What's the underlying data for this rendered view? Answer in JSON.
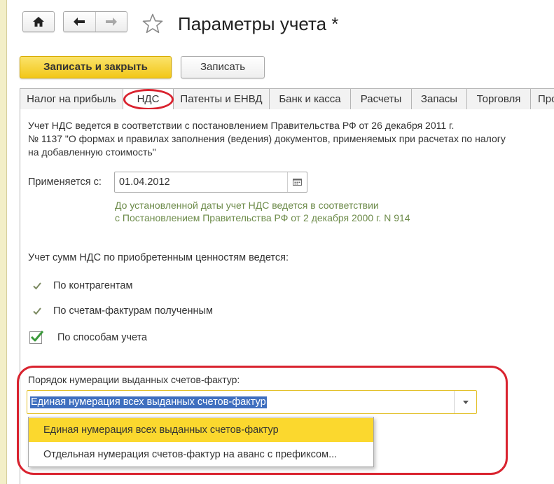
{
  "header": {
    "title": "Параметры учета *"
  },
  "toolbar": {
    "save_close_label": "Записать и закрыть",
    "save_label": "Записать"
  },
  "tabs": [
    {
      "label": "Налог на прибыль",
      "active": false
    },
    {
      "label": "НДС",
      "active": true
    },
    {
      "label": "Патенты и ЕНВД",
      "active": false
    },
    {
      "label": "Банк и касса",
      "active": false
    },
    {
      "label": "Расчеты",
      "active": false
    },
    {
      "label": "Запасы",
      "active": false
    },
    {
      "label": "Торговля",
      "active": false
    },
    {
      "label": "Про",
      "active": false
    }
  ],
  "vat": {
    "intro_lines": [
      "Учет НДС ведется в соответствии с постановлением Правительства РФ от 26 декабря 2011 г.",
      "№ 1137 \"О формах и правилах заполнения (ведения) документов, применяемых при расчетах по налогу",
      "на добавленную стоимость\""
    ],
    "applied_from_label": "Применяется с:",
    "applied_from_value": "01.04.2012",
    "hint_lines": [
      "До установленной даты учет НДС ведется в соответствии",
      "с Постановлением Правительства РФ от 2 декабря 2000 г. N 914"
    ],
    "tracking_label": "Учет сумм НДС по приобретенным ценностям ведется:",
    "tracking_options": [
      {
        "label": "По контрагентам",
        "type": "fixed-tick"
      },
      {
        "label": "По счетам-фактурам полученным",
        "type": "fixed-tick"
      },
      {
        "label": "По способам учета",
        "type": "checkbox",
        "checked": true
      }
    ],
    "numbering_label": "Порядок нумерации выданных счетов-фактур:",
    "numbering_value": "Единая нумерация всех выданных счетов-фактур",
    "numbering_options": [
      "Единая нумерация всех выданных счетов-фактур",
      "Отдельная нумерация счетов-фактур на аванс с префиксом..."
    ]
  },
  "colors": {
    "primary_button": "#f2c718",
    "highlight_annotation": "#d9232f",
    "hint_text": "#6d8b4a",
    "selection": "#3f6fbf",
    "dropdown_selected": "#fbd82e",
    "check_green": "#3c9a3c"
  },
  "icons": {
    "home": "home-icon",
    "back": "arrow-left-icon",
    "forward": "arrow-right-icon",
    "favorite": "star-outline-icon",
    "calendar": "calendar-icon",
    "dropdown": "chevron-down-icon"
  }
}
